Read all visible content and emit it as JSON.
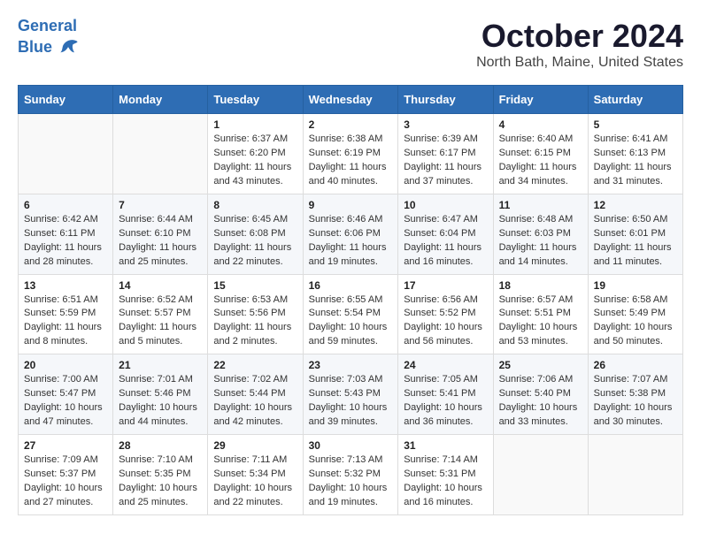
{
  "header": {
    "logo_line1": "General",
    "logo_line2": "Blue",
    "title": "October 2024",
    "subtitle": "North Bath, Maine, United States"
  },
  "days_of_week": [
    "Sunday",
    "Monday",
    "Tuesday",
    "Wednesday",
    "Thursday",
    "Friday",
    "Saturday"
  ],
  "weeks": [
    [
      {
        "day": "",
        "info": ""
      },
      {
        "day": "",
        "info": ""
      },
      {
        "day": "1",
        "info": "Sunrise: 6:37 AM\nSunset: 6:20 PM\nDaylight: 11 hours and 43 minutes."
      },
      {
        "day": "2",
        "info": "Sunrise: 6:38 AM\nSunset: 6:19 PM\nDaylight: 11 hours and 40 minutes."
      },
      {
        "day": "3",
        "info": "Sunrise: 6:39 AM\nSunset: 6:17 PM\nDaylight: 11 hours and 37 minutes."
      },
      {
        "day": "4",
        "info": "Sunrise: 6:40 AM\nSunset: 6:15 PM\nDaylight: 11 hours and 34 minutes."
      },
      {
        "day": "5",
        "info": "Sunrise: 6:41 AM\nSunset: 6:13 PM\nDaylight: 11 hours and 31 minutes."
      }
    ],
    [
      {
        "day": "6",
        "info": "Sunrise: 6:42 AM\nSunset: 6:11 PM\nDaylight: 11 hours and 28 minutes."
      },
      {
        "day": "7",
        "info": "Sunrise: 6:44 AM\nSunset: 6:10 PM\nDaylight: 11 hours and 25 minutes."
      },
      {
        "day": "8",
        "info": "Sunrise: 6:45 AM\nSunset: 6:08 PM\nDaylight: 11 hours and 22 minutes."
      },
      {
        "day": "9",
        "info": "Sunrise: 6:46 AM\nSunset: 6:06 PM\nDaylight: 11 hours and 19 minutes."
      },
      {
        "day": "10",
        "info": "Sunrise: 6:47 AM\nSunset: 6:04 PM\nDaylight: 11 hours and 16 minutes."
      },
      {
        "day": "11",
        "info": "Sunrise: 6:48 AM\nSunset: 6:03 PM\nDaylight: 11 hours and 14 minutes."
      },
      {
        "day": "12",
        "info": "Sunrise: 6:50 AM\nSunset: 6:01 PM\nDaylight: 11 hours and 11 minutes."
      }
    ],
    [
      {
        "day": "13",
        "info": "Sunrise: 6:51 AM\nSunset: 5:59 PM\nDaylight: 11 hours and 8 minutes."
      },
      {
        "day": "14",
        "info": "Sunrise: 6:52 AM\nSunset: 5:57 PM\nDaylight: 11 hours and 5 minutes."
      },
      {
        "day": "15",
        "info": "Sunrise: 6:53 AM\nSunset: 5:56 PM\nDaylight: 11 hours and 2 minutes."
      },
      {
        "day": "16",
        "info": "Sunrise: 6:55 AM\nSunset: 5:54 PM\nDaylight: 10 hours and 59 minutes."
      },
      {
        "day": "17",
        "info": "Sunrise: 6:56 AM\nSunset: 5:52 PM\nDaylight: 10 hours and 56 minutes."
      },
      {
        "day": "18",
        "info": "Sunrise: 6:57 AM\nSunset: 5:51 PM\nDaylight: 10 hours and 53 minutes."
      },
      {
        "day": "19",
        "info": "Sunrise: 6:58 AM\nSunset: 5:49 PM\nDaylight: 10 hours and 50 minutes."
      }
    ],
    [
      {
        "day": "20",
        "info": "Sunrise: 7:00 AM\nSunset: 5:47 PM\nDaylight: 10 hours and 47 minutes."
      },
      {
        "day": "21",
        "info": "Sunrise: 7:01 AM\nSunset: 5:46 PM\nDaylight: 10 hours and 44 minutes."
      },
      {
        "day": "22",
        "info": "Sunrise: 7:02 AM\nSunset: 5:44 PM\nDaylight: 10 hours and 42 minutes."
      },
      {
        "day": "23",
        "info": "Sunrise: 7:03 AM\nSunset: 5:43 PM\nDaylight: 10 hours and 39 minutes."
      },
      {
        "day": "24",
        "info": "Sunrise: 7:05 AM\nSunset: 5:41 PM\nDaylight: 10 hours and 36 minutes."
      },
      {
        "day": "25",
        "info": "Sunrise: 7:06 AM\nSunset: 5:40 PM\nDaylight: 10 hours and 33 minutes."
      },
      {
        "day": "26",
        "info": "Sunrise: 7:07 AM\nSunset: 5:38 PM\nDaylight: 10 hours and 30 minutes."
      }
    ],
    [
      {
        "day": "27",
        "info": "Sunrise: 7:09 AM\nSunset: 5:37 PM\nDaylight: 10 hours and 27 minutes."
      },
      {
        "day": "28",
        "info": "Sunrise: 7:10 AM\nSunset: 5:35 PM\nDaylight: 10 hours and 25 minutes."
      },
      {
        "day": "29",
        "info": "Sunrise: 7:11 AM\nSunset: 5:34 PM\nDaylight: 10 hours and 22 minutes."
      },
      {
        "day": "30",
        "info": "Sunrise: 7:13 AM\nSunset: 5:32 PM\nDaylight: 10 hours and 19 minutes."
      },
      {
        "day": "31",
        "info": "Sunrise: 7:14 AM\nSunset: 5:31 PM\nDaylight: 10 hours and 16 minutes."
      },
      {
        "day": "",
        "info": ""
      },
      {
        "day": "",
        "info": ""
      }
    ]
  ]
}
